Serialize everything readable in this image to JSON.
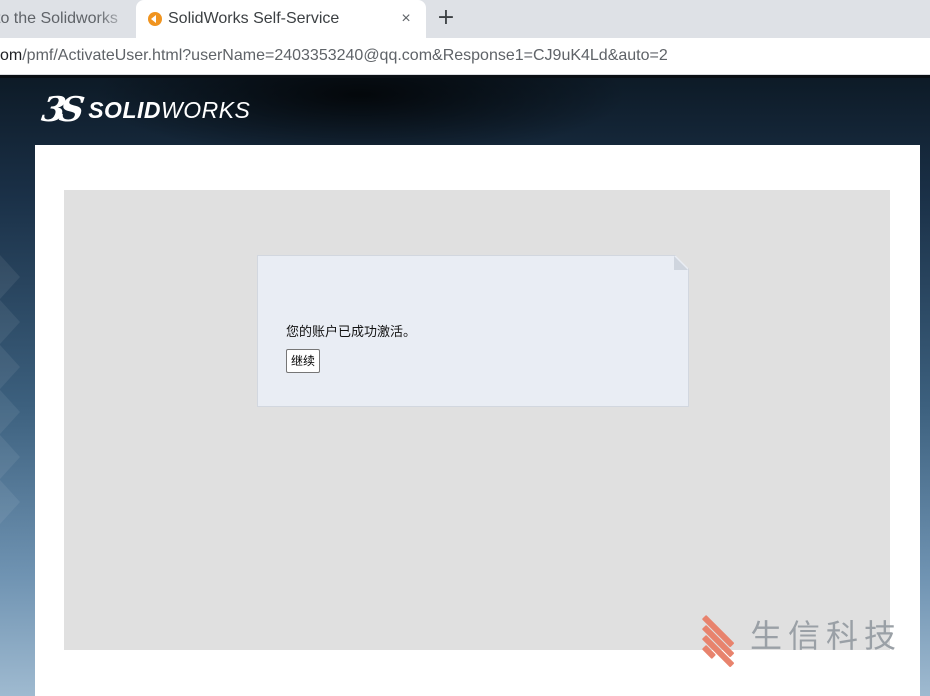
{
  "browser": {
    "tabs": [
      {
        "title": "to the Solidworks",
        "active": false
      },
      {
        "title": "SolidWorks Self-Service",
        "active": true
      }
    ],
    "close_glyph": "×",
    "new_tab_glyph": "+",
    "url_host": "om",
    "url_path": "/pmf/ActivateUser.html?userName=2403353240@qq.com&Response1=CJ9uK4Ld&auto=2"
  },
  "header": {
    "logo_mark": "3S",
    "logo_bold": "SOLID",
    "logo_light": "WORKS"
  },
  "dialog": {
    "message": "您的账户已成功激活。",
    "continue_label": "继续"
  },
  "watermark": {
    "text": "生信科技"
  },
  "colors": {
    "tab_bar": "#dee1e6",
    "panel": "#e0e0e0",
    "dialog": "#e9edf4",
    "favicon": "#f0941f",
    "watermark_accent": "#e8836d"
  },
  "icons": {
    "favicon": "solidworks-favicon-icon",
    "close": "close-icon",
    "new_tab": "plus-icon"
  }
}
